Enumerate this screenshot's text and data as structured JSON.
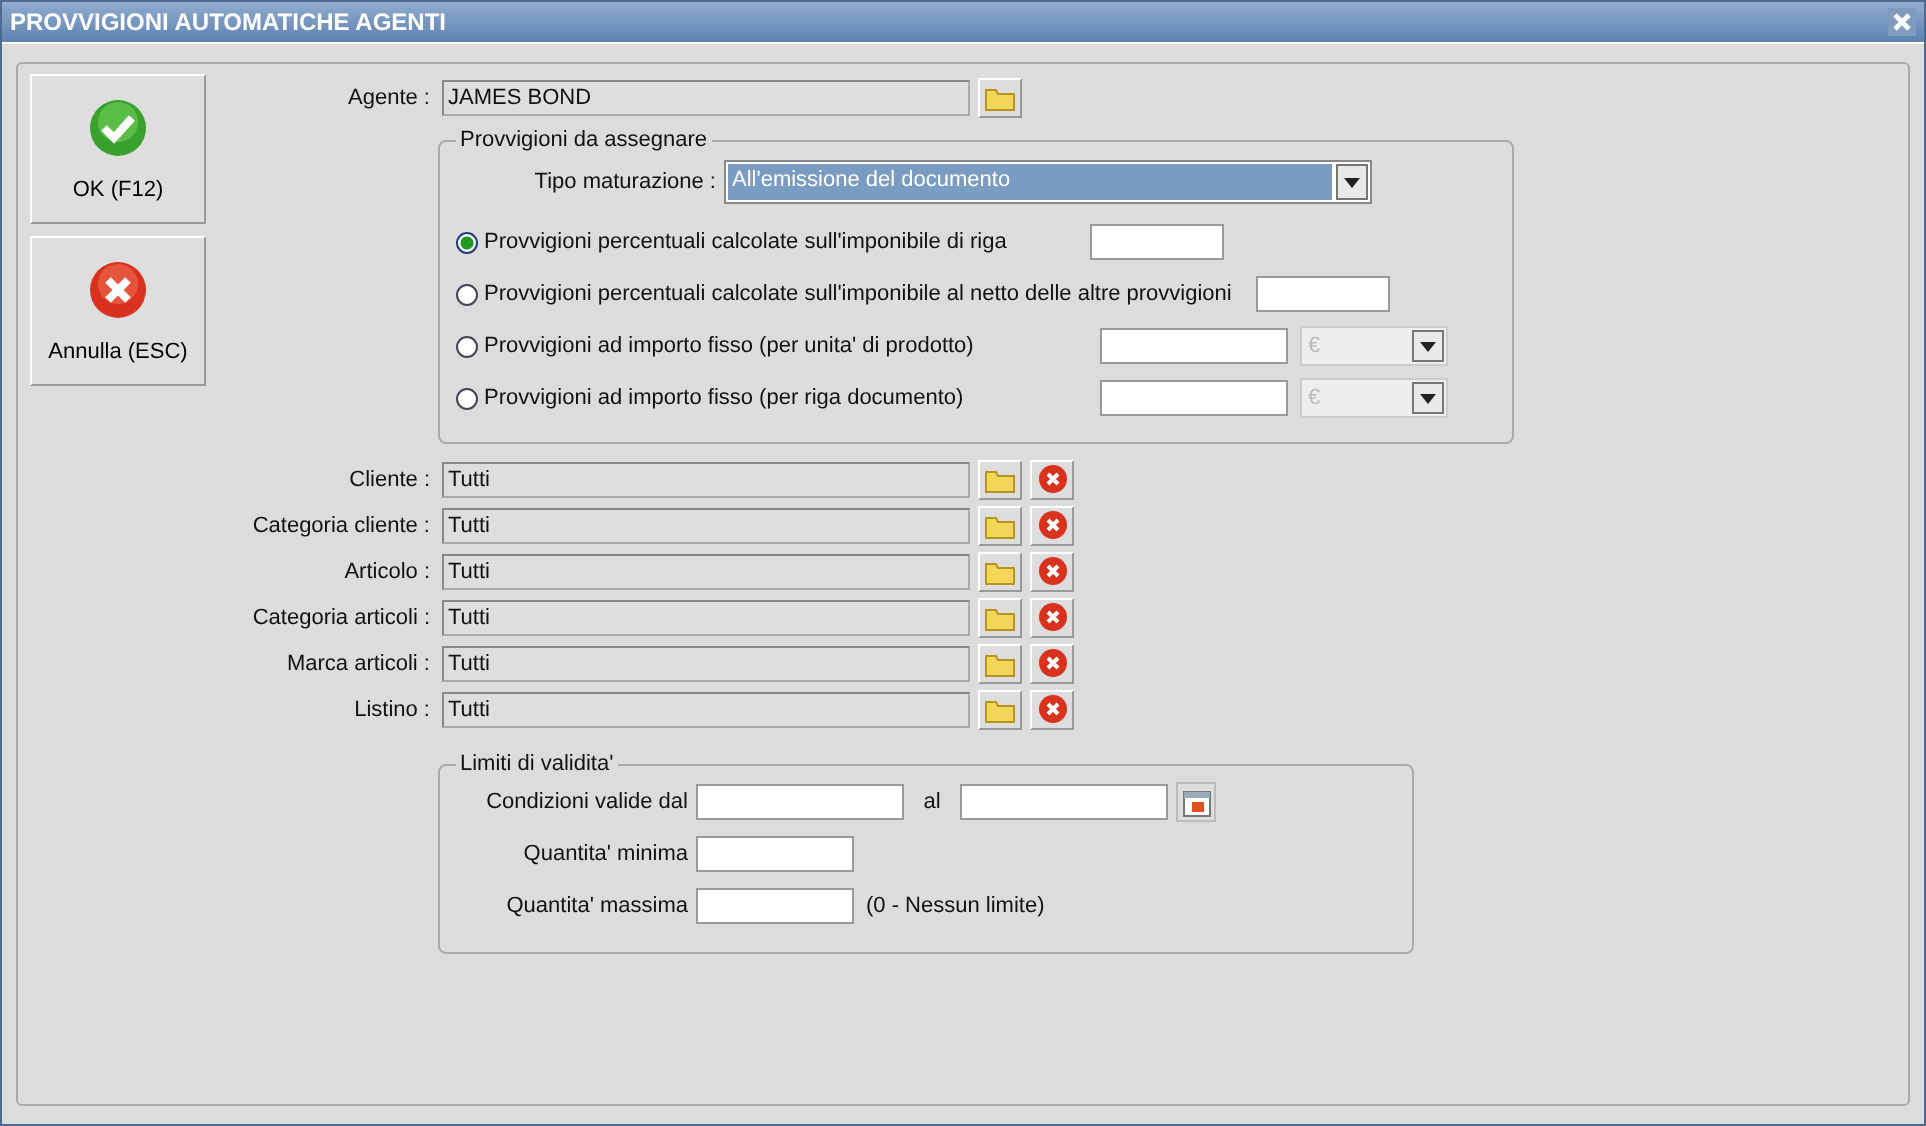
{
  "window": {
    "title": "PROVVIGIONI AUTOMATICHE AGENTI"
  },
  "actions": [
    {
      "label": "OK (F12)",
      "kind": "ok"
    },
    {
      "label": "Annulla (ESC)",
      "kind": "cancel"
    }
  ],
  "agent": {
    "label": "Agente :",
    "value": "JAMES BOND"
  },
  "commission_group": {
    "title": "Provvigioni da assegnare",
    "maturation": {
      "label": "Tipo maturazione :",
      "value": "All'emissione del documento"
    },
    "options": [
      {
        "label": "Provvigioni percentuali calcolate sull'imponibile di riga",
        "selected": true,
        "kind": "percent"
      },
      {
        "label": "Provvigioni percentuali calcolate sull'imponibile al netto delle altre provvigioni",
        "selected": false,
        "kind": "percent"
      },
      {
        "label": "Provvigioni ad importo fisso (per unita' di prodotto)",
        "selected": false,
        "kind": "amount",
        "currency": "€"
      },
      {
        "label": "Provvigioni ad importo fisso (per riga documento)",
        "selected": false,
        "kind": "amount",
        "currency": "€"
      }
    ]
  },
  "filters": [
    {
      "label": "Cliente :",
      "value": "Tutti"
    },
    {
      "label": "Categoria cliente :",
      "value": "Tutti"
    },
    {
      "label": "Articolo :",
      "value": "Tutti"
    },
    {
      "label": "Categoria articoli :",
      "value": "Tutti"
    },
    {
      "label": "Marca articoli :",
      "value": "Tutti"
    },
    {
      "label": "Listino :",
      "value": "Tutti"
    }
  ],
  "validity": {
    "title": "Limiti di validita'",
    "from_label": "Condizioni valide dal",
    "to_label": "al",
    "min_label": "Quantita' minima",
    "max_label": "Quantita' massima",
    "max_hint": "(0 - Nessun limite)"
  }
}
